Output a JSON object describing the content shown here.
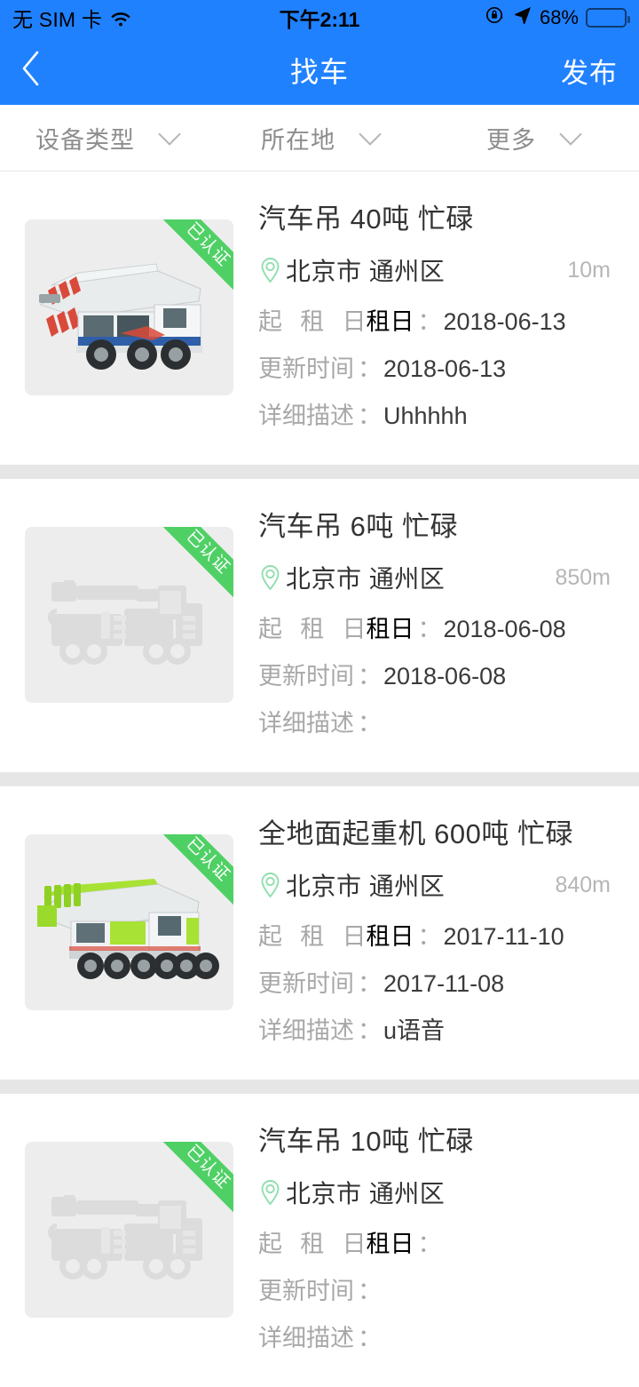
{
  "statusbar": {
    "carrier": "无 SIM 卡",
    "wifi_icon": "wifi-icon",
    "time": "下午2:11",
    "rotation_lock_icon": "rotation-lock-icon",
    "location_icon": "location-arrow-icon",
    "battery_percent": "68%",
    "battery_level": 68
  },
  "navbar": {
    "back_icon": "back-chevron-icon",
    "title": "找车",
    "action_label": "发布"
  },
  "filters": [
    {
      "label": "设备类型",
      "icon": "chevron-down-icon"
    },
    {
      "label": "所在地",
      "icon": "chevron-down-icon"
    },
    {
      "label": "更多",
      "icon": "chevron-down-icon"
    }
  ],
  "labels": {
    "rent_date": "起 租 日",
    "update_time": "更新时间",
    "description": "详细描述",
    "colon": "：",
    "verified_badge": "已认证",
    "pin_icon": "location-pin-icon"
  },
  "colors": {
    "primary_blue": "#2081FF",
    "badge_green": "#4fd065",
    "pin_green": "#8fdfae",
    "separator_gray": "#e6e6e6"
  },
  "listings": [
    {
      "title": "汽车吊 40吨 忙碌",
      "location": "北京市 通州区",
      "distance": "10m",
      "rent_date": "2018-06-13",
      "update_time": "2018-06-13",
      "description": "Uhhhhh",
      "verified": "已认证",
      "image_type": "photo-white-crane"
    },
    {
      "title": "汽车吊 6吨 忙碌",
      "location": "北京市 通州区",
      "distance": "850m",
      "rent_date": "2018-06-08",
      "update_time": "2018-06-08",
      "description": "",
      "verified": "已认证",
      "image_type": "placeholder-crane"
    },
    {
      "title": "全地面起重机 600吨 忙碌",
      "location": "北京市 通州区",
      "distance": "840m",
      "rent_date": "2017-11-10",
      "update_time": "2017-11-08",
      "description": "u语音",
      "verified": "已认证",
      "image_type": "photo-green-crane"
    },
    {
      "title": "汽车吊 10吨 忙碌",
      "location": "北京市 通州区",
      "distance": "",
      "rent_date": "",
      "update_time": "",
      "description": "",
      "verified": "已认证",
      "image_type": "placeholder-crane"
    }
  ]
}
